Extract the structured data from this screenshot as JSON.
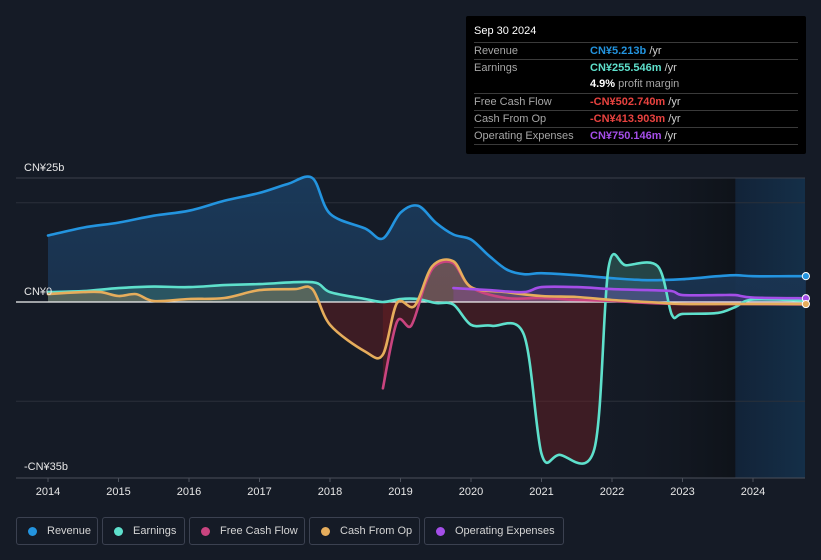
{
  "tooltip": {
    "date": "Sep 30 2024",
    "rows": [
      {
        "label": "Revenue",
        "value": "CN¥5.213b",
        "unit": " /yr",
        "color": "#2394df"
      },
      {
        "label": "Earnings",
        "value": "CN¥255.546m",
        "unit": " /yr",
        "color": "#5ee0cc"
      },
      {
        "label": "",
        "value": "4.9%",
        "unit": " profit margin",
        "color": "#ffffff"
      },
      {
        "label": "Free Cash Flow",
        "value": "-CN¥502.740m",
        "unit": " /yr",
        "color": "#e8423f"
      },
      {
        "label": "Cash From Op",
        "value": "-CN¥413.903m",
        "unit": " /yr",
        "color": "#e8423f"
      },
      {
        "label": "Operating Expenses",
        "value": "CN¥750.146m",
        "unit": " /yr",
        "color": "#a44ee8"
      }
    ]
  },
  "legend": [
    {
      "label": "Revenue",
      "color": "#2394df"
    },
    {
      "label": "Earnings",
      "color": "#5ee0cc"
    },
    {
      "label": "Free Cash Flow",
      "color": "#c9447f"
    },
    {
      "label": "Cash From Op",
      "color": "#e6ad5c"
    },
    {
      "label": "Operating Expenses",
      "color": "#a44ee8"
    }
  ],
  "chart_data": {
    "type": "line",
    "title": "",
    "xlabel": "",
    "ylabel": "",
    "y_tick_labels": [
      "CN¥25b",
      "CN¥0",
      "-CN¥35b"
    ],
    "x_tick_labels": [
      "2014",
      "2015",
      "2016",
      "2017",
      "2018",
      "2019",
      "2020",
      "2021",
      "2022",
      "2023",
      "2024"
    ],
    "ylim": [
      -35,
      25
    ],
    "xlim": [
      2013.7,
      2024.75
    ],
    "forecast_shade_start": 2023.75,
    "units": "CN¥ billions",
    "series": [
      {
        "name": "Revenue",
        "color": "#2394df",
        "points": [
          [
            2014.0,
            13.4
          ],
          [
            2014.5,
            15.0
          ],
          [
            2015.0,
            16.0
          ],
          [
            2015.5,
            17.4
          ],
          [
            2016.0,
            18.4
          ],
          [
            2016.5,
            20.4
          ],
          [
            2017.0,
            22.0
          ],
          [
            2017.4,
            23.8
          ],
          [
            2017.75,
            25.0
          ],
          [
            2018.0,
            17.8
          ],
          [
            2018.5,
            14.8
          ],
          [
            2018.75,
            12.8
          ],
          [
            2019.0,
            18.0
          ],
          [
            2019.25,
            19.4
          ],
          [
            2019.5,
            16.0
          ],
          [
            2019.75,
            13.6
          ],
          [
            2020.0,
            12.6
          ],
          [
            2020.25,
            9.4
          ],
          [
            2020.5,
            6.6
          ],
          [
            2020.75,
            5.6
          ],
          [
            2021.0,
            5.8
          ],
          [
            2021.5,
            5.4
          ],
          [
            2022.0,
            4.8
          ],
          [
            2022.5,
            4.4
          ],
          [
            2023.0,
            4.6
          ],
          [
            2023.5,
            5.2
          ],
          [
            2023.75,
            5.4
          ],
          [
            2024.0,
            5.2
          ],
          [
            2024.5,
            5.2
          ],
          [
            2024.75,
            5.213
          ]
        ]
      },
      {
        "name": "Earnings",
        "color": "#5ee0cc",
        "points": [
          [
            2014.0,
            2.0
          ],
          [
            2014.5,
            2.2
          ],
          [
            2015.0,
            2.8
          ],
          [
            2015.5,
            3.1
          ],
          [
            2016.0,
            3.0
          ],
          [
            2016.5,
            3.4
          ],
          [
            2017.0,
            3.6
          ],
          [
            2017.75,
            4.0
          ],
          [
            2018.0,
            2.0
          ],
          [
            2018.5,
            0.6
          ],
          [
            2018.75,
            0.0
          ],
          [
            2019.0,
            0.6
          ],
          [
            2019.25,
            0.6
          ],
          [
            2019.5,
            -0.2
          ],
          [
            2019.75,
            -0.5
          ],
          [
            2020.0,
            -4.6
          ],
          [
            2020.3,
            -4.8
          ],
          [
            2020.75,
            -6.6
          ],
          [
            2021.0,
            -30.6
          ],
          [
            2021.25,
            -30.8
          ],
          [
            2021.75,
            -29.6
          ],
          [
            2021.95,
            6.9
          ],
          [
            2022.2,
            7.4
          ],
          [
            2022.65,
            7.2
          ],
          [
            2022.85,
            -2.6
          ],
          [
            2023.0,
            -2.4
          ],
          [
            2023.5,
            -2.2
          ],
          [
            2023.75,
            -1.0
          ],
          [
            2024.0,
            0.5
          ],
          [
            2024.75,
            0.256
          ]
        ]
      },
      {
        "name": "Free Cash Flow",
        "color": "#c9447f",
        "points": [
          [
            2018.75,
            -17.4
          ],
          [
            2018.95,
            -4.0
          ],
          [
            2019.15,
            -4.8
          ],
          [
            2019.35,
            3.6
          ],
          [
            2019.5,
            7.4
          ],
          [
            2019.75,
            7.8
          ],
          [
            2020.0,
            3.0
          ],
          [
            2020.5,
            0.8
          ],
          [
            2021.0,
            0.8
          ],
          [
            2021.5,
            0.4
          ],
          [
            2022.0,
            0.2
          ],
          [
            2022.5,
            -0.2
          ],
          [
            2023.0,
            -0.4
          ],
          [
            2023.75,
            -0.4
          ],
          [
            2024.75,
            -0.503
          ]
        ]
      },
      {
        "name": "Cash From Op",
        "color": "#e6ad5c",
        "points": [
          [
            2014.0,
            1.6
          ],
          [
            2014.5,
            2.0
          ],
          [
            2014.75,
            2.0
          ],
          [
            2015.0,
            1.2
          ],
          [
            2015.25,
            1.6
          ],
          [
            2015.5,
            0.2
          ],
          [
            2016.0,
            0.6
          ],
          [
            2016.5,
            0.8
          ],
          [
            2017.0,
            2.4
          ],
          [
            2017.5,
            2.6
          ],
          [
            2017.75,
            2.6
          ],
          [
            2018.0,
            -4.6
          ],
          [
            2018.5,
            -10.0
          ],
          [
            2018.75,
            -10.6
          ],
          [
            2018.95,
            -0.2
          ],
          [
            2019.2,
            -0.8
          ],
          [
            2019.45,
            7.2
          ],
          [
            2019.75,
            8.2
          ],
          [
            2020.0,
            3.0
          ],
          [
            2020.5,
            2.0
          ],
          [
            2021.0,
            1.2
          ],
          [
            2021.5,
            1.0
          ],
          [
            2022.0,
            0.4
          ],
          [
            2022.5,
            0.0
          ],
          [
            2023.0,
            -0.4
          ],
          [
            2023.75,
            -0.4
          ],
          [
            2024.75,
            -0.414
          ]
        ]
      },
      {
        "name": "Operating Expenses",
        "color": "#a44ee8",
        "points": [
          [
            2019.75,
            2.8
          ],
          [
            2020.25,
            2.4
          ],
          [
            2020.75,
            2.0
          ],
          [
            2021.0,
            3.0
          ],
          [
            2021.5,
            3.0
          ],
          [
            2022.0,
            2.6
          ],
          [
            2022.5,
            2.4
          ],
          [
            2022.85,
            2.2
          ],
          [
            2023.0,
            1.4
          ],
          [
            2023.5,
            1.4
          ],
          [
            2023.75,
            1.4
          ],
          [
            2024.0,
            0.9
          ],
          [
            2024.75,
            0.75
          ]
        ]
      }
    ]
  }
}
